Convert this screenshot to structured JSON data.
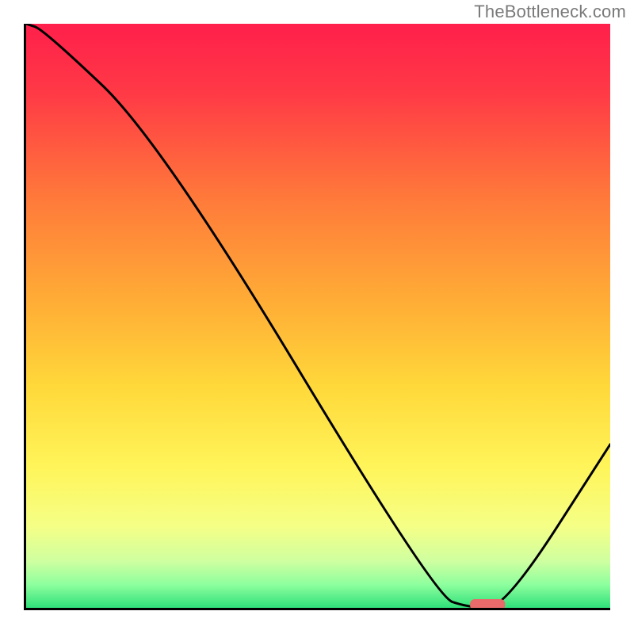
{
  "watermark": "TheBottleneck.com",
  "chart_data": {
    "type": "line",
    "title": "",
    "xlabel": "",
    "ylabel": "",
    "xlim": [
      0,
      100
    ],
    "ylim": [
      0,
      100
    ],
    "x": [
      0,
      3,
      23,
      70,
      76,
      82,
      100
    ],
    "y": [
      100,
      99,
      80,
      2,
      0,
      0,
      28
    ],
    "curve_points": [
      {
        "x": 0.0,
        "y": 100.0
      },
      {
        "x": 3.0,
        "y": 99.0
      },
      {
        "x": 23.0,
        "y": 80.0
      },
      {
        "x": 70.0,
        "y": 2.0
      },
      {
        "x": 76.0,
        "y": 0.0
      },
      {
        "x": 82.0,
        "y": 0.0
      },
      {
        "x": 100.0,
        "y": 28.0
      }
    ],
    "optimum_marker": {
      "x_start": 76,
      "x_end": 82,
      "y": 0,
      "color": "#e86a6a"
    },
    "gradient_stops": [
      {
        "pct": 0,
        "color": "#ff1f4b"
      },
      {
        "pct": 12,
        "color": "#ff3a46"
      },
      {
        "pct": 30,
        "color": "#ff7a3a"
      },
      {
        "pct": 48,
        "color": "#ffae36"
      },
      {
        "pct": 62,
        "color": "#ffd83a"
      },
      {
        "pct": 76,
        "color": "#fff55a"
      },
      {
        "pct": 86,
        "color": "#f5ff86"
      },
      {
        "pct": 92,
        "color": "#cfffa0"
      },
      {
        "pct": 96,
        "color": "#8eff9e"
      },
      {
        "pct": 100,
        "color": "#2fe07a"
      }
    ],
    "grid": false,
    "legend": false
  }
}
